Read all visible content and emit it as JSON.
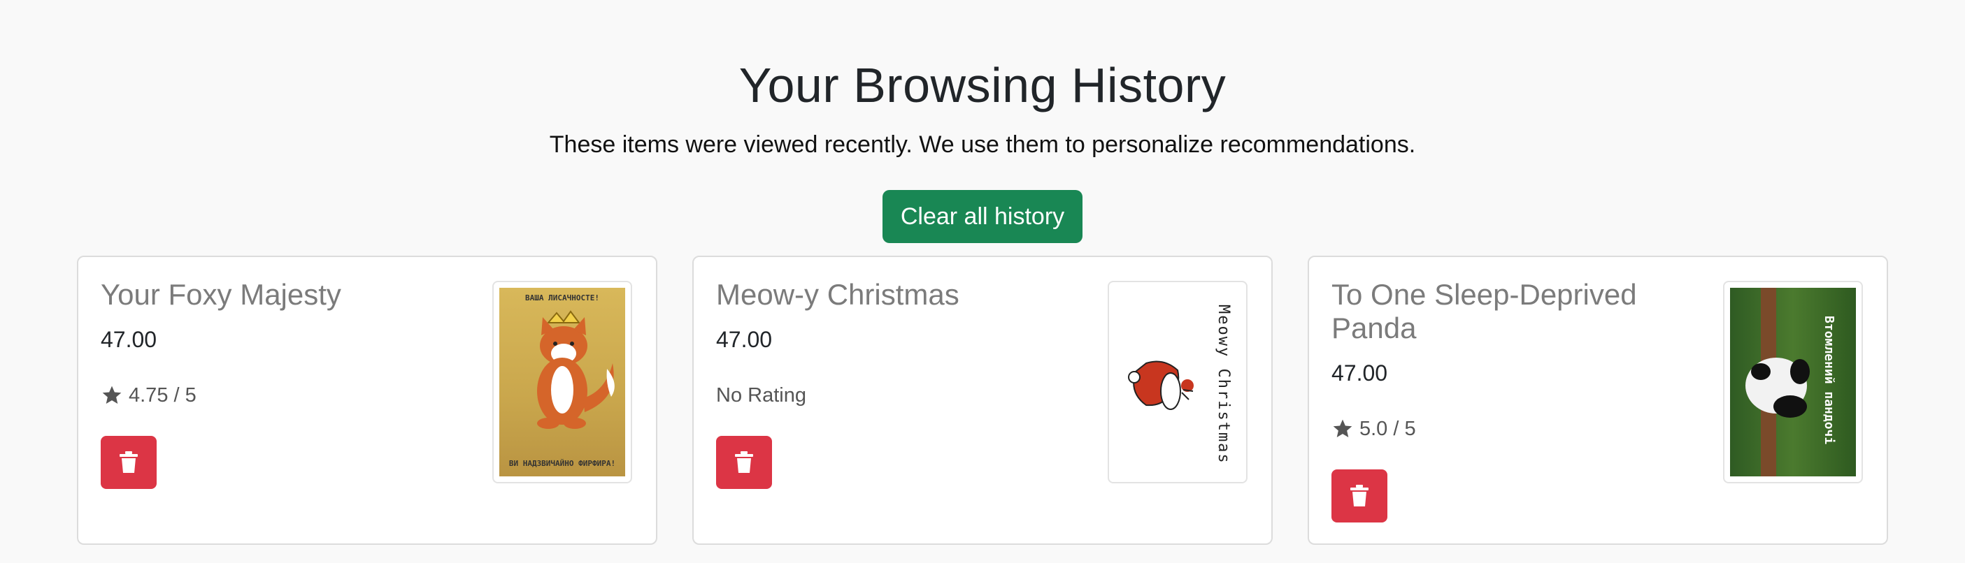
{
  "header": {
    "title": "Your Browsing History",
    "subtitle": "These items were viewed recently. We use them to personalize recommendations.",
    "clear_button": "Clear all history"
  },
  "items": [
    {
      "title": "Your Foxy Majesty",
      "price": "47.00",
      "rating": "4.75 / 5",
      "has_rating": true,
      "image": {
        "top_text": "ВАША ЛИСАЧНОСТЕ!",
        "bottom_text": "ВИ НАДЗВИЧАЙНО ФИРФИРА!"
      }
    },
    {
      "title": "Meow-y Christmas",
      "price": "47.00",
      "rating": "No Rating",
      "has_rating": false,
      "image": {
        "text": "Meowy Christmas"
      }
    },
    {
      "title": "To One Sleep-Deprived Panda",
      "price": "47.00",
      "rating": "5.0 / 5",
      "has_rating": true,
      "image": {
        "text": "Втомлений пандочі"
      }
    }
  ],
  "colors": {
    "clear_button": "#198754",
    "delete_button": "#dc3545",
    "title_gray": "#7b7b7b"
  },
  "icons": {
    "delete": "trash-icon",
    "rating": "star-icon"
  }
}
